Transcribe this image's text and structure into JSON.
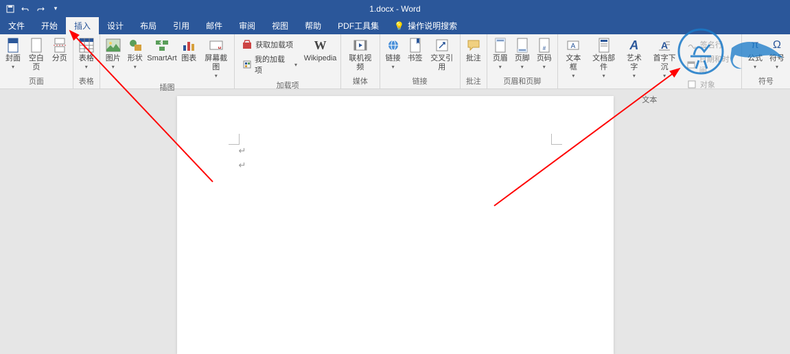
{
  "title": "1.docx - Word",
  "qat": {
    "save": "保存",
    "undo": "撤销",
    "redo": "重做"
  },
  "tabs": {
    "file": "文件",
    "home": "开始",
    "insert": "插入",
    "design": "设计",
    "layout": "布局",
    "references": "引用",
    "mailings": "邮件",
    "review": "审阅",
    "view": "视图",
    "help": "帮助",
    "pdftools": "PDF工具集"
  },
  "tell_me": "操作说明搜索",
  "ribbon": {
    "pages": {
      "label": "页面",
      "cover": "封面",
      "blank": "空白页",
      "break": "分页"
    },
    "tables": {
      "label": "表格",
      "table": "表格"
    },
    "illustrations": {
      "label": "插图",
      "pictures": "图片",
      "shapes": "形状",
      "smartart": "SmartArt",
      "chart": "图表",
      "screenshot": "屏幕截图"
    },
    "addins": {
      "label": "加载项",
      "get": "获取加载项",
      "my": "我的加载项",
      "wikipedia": "Wikipedia"
    },
    "media": {
      "label": "媒体",
      "video": "联机视频"
    },
    "links": {
      "label": "链接",
      "link": "链接",
      "bookmark": "书签",
      "crossref": "交叉引用"
    },
    "comments": {
      "label": "批注",
      "comment": "批注"
    },
    "headerfooter": {
      "label": "页眉和页脚",
      "header": "页眉",
      "footer": "页脚",
      "pagenum": "页码"
    },
    "text": {
      "label": "文本",
      "textbox": "文本框",
      "quickparts": "文档部件",
      "wordart": "艺术字",
      "dropcap": "首字下沉",
      "signature": "签名行",
      "datetime": "日期和时间",
      "object": "对象"
    },
    "symbols": {
      "label": "符号",
      "equation": "公式",
      "symbol": "符号"
    }
  }
}
